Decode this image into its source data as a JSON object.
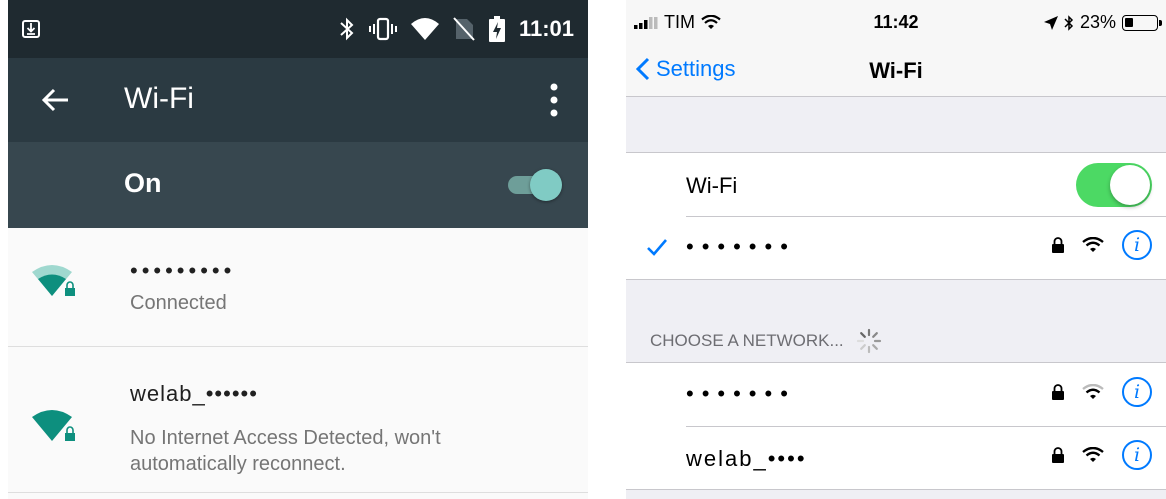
{
  "android": {
    "status": {
      "time": "11:01"
    },
    "toolbar": {
      "title": "Wi-Fi"
    },
    "master": {
      "label": "On",
      "enabled": true
    },
    "networks": [
      {
        "ssid": "•••••••••",
        "status": "Connected"
      },
      {
        "ssid": "welab_••••••",
        "status": "No Internet Access Detected, won't automatically reconnect."
      }
    ],
    "accent": "#80cbc4"
  },
  "ios": {
    "status": {
      "carrier": "TIM",
      "time": "11:42",
      "battery": "23%"
    },
    "nav": {
      "back_label": "Settings",
      "title": "Wi-Fi"
    },
    "wifi_row": {
      "label": "Wi-Fi",
      "enabled": true
    },
    "connected": {
      "ssid": "•••••••"
    },
    "section_header": "CHOOSE A NETWORK...",
    "networks": [
      {
        "ssid": "•••••••"
      },
      {
        "ssid": "welab_••••"
      }
    ],
    "info_glyph": "i",
    "accent": "#007aff",
    "switch_color": "#4cd964"
  }
}
